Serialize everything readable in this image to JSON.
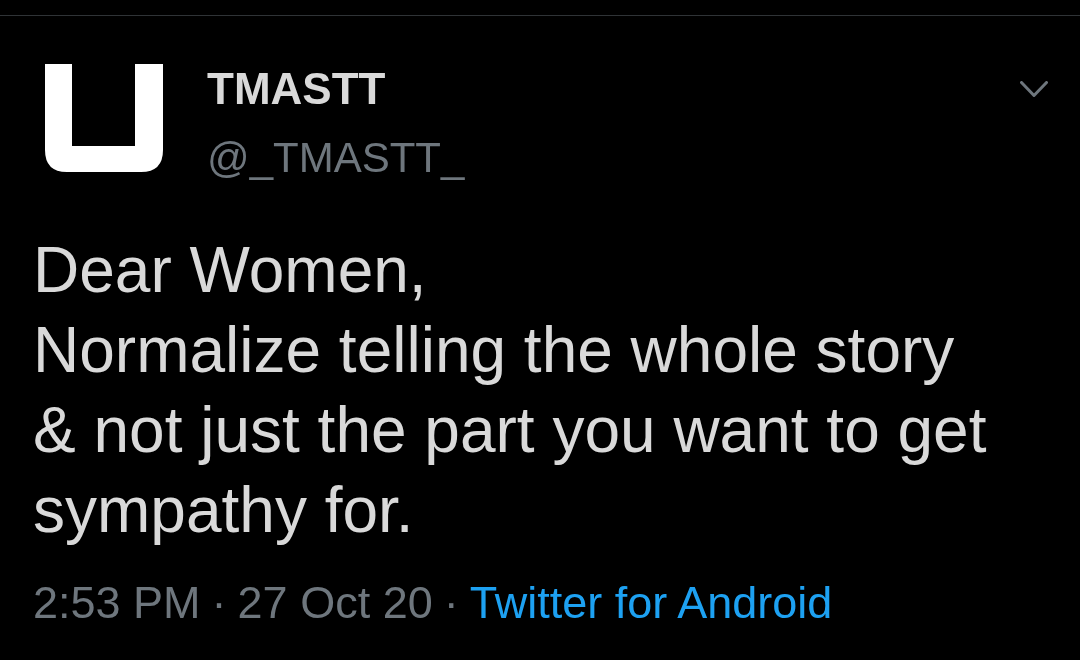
{
  "tweet": {
    "author": {
      "name": "TMASTT",
      "handle": "@_TMASTT_"
    },
    "text": "Dear Women,\nNormalize telling the whole story\n& not just the part you want to get\nsympathy for.",
    "meta": [
      {
        "kind": "plain",
        "text": "2:53 PM"
      },
      {
        "kind": "separator",
        "text": "·"
      },
      {
        "kind": "plain",
        "text": "27 Oct 20"
      },
      {
        "kind": "separator",
        "text": "·"
      },
      {
        "kind": "link",
        "text": "Twitter for Android"
      }
    ]
  }
}
